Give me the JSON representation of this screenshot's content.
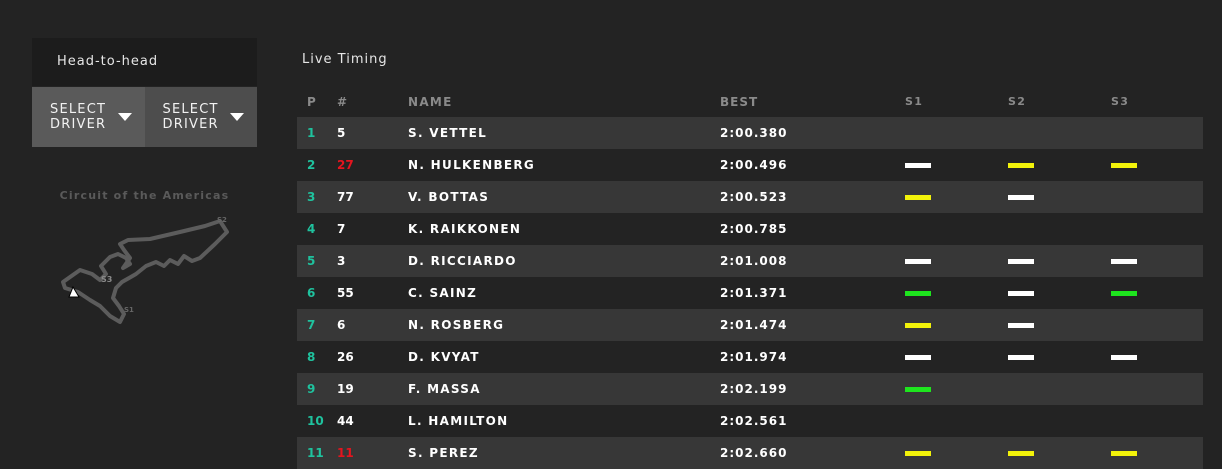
{
  "head_to_head": {
    "title": "Head-to-head",
    "select_a": "SELECT\nDRIVER",
    "select_b": "SELECT\nDRIVER"
  },
  "circuit": {
    "name": "Circuit of the Americas",
    "labels": {
      "s1": "S1",
      "s2": "S2",
      "s3": "S3"
    }
  },
  "live_timing": {
    "title": "Live Timing",
    "columns": {
      "p": "P",
      "num": "#",
      "name": "NAME",
      "best": "BEST",
      "s1": "S1",
      "s2": "S2",
      "s3": "S3"
    },
    "colors": {
      "white": "#ffffff",
      "yellow": "#f2f20a",
      "green": "#1ee51e",
      "teal": "#1fc29e",
      "red": "#e5141e"
    },
    "rows": [
      {
        "p": "1",
        "num": "5",
        "num_color": "#ffffff",
        "name": "S. VETTEL",
        "best": "2:00.380",
        "s1": "",
        "s2": "",
        "s3": ""
      },
      {
        "p": "2",
        "num": "27",
        "num_color": "#e5141e",
        "name": "N. HULKENBERG",
        "best": "2:00.496",
        "s1": "white",
        "s2": "yellow",
        "s3": "yellow"
      },
      {
        "p": "3",
        "num": "77",
        "num_color": "#ffffff",
        "name": "V. BOTTAS",
        "best": "2:00.523",
        "s1": "yellow",
        "s2": "white",
        "s3": ""
      },
      {
        "p": "4",
        "num": "7",
        "num_color": "#ffffff",
        "name": "K. RAIKKONEN",
        "best": "2:00.785",
        "s1": "",
        "s2": "",
        "s3": ""
      },
      {
        "p": "5",
        "num": "3",
        "num_color": "#ffffff",
        "name": "D. RICCIARDO",
        "best": "2:01.008",
        "s1": "white",
        "s2": "white",
        "s3": "white"
      },
      {
        "p": "6",
        "num": "55",
        "num_color": "#ffffff",
        "name": "C. SAINZ",
        "best": "2:01.371",
        "s1": "green",
        "s2": "white",
        "s3": "green"
      },
      {
        "p": "7",
        "num": "6",
        "num_color": "#ffffff",
        "name": "N. ROSBERG",
        "best": "2:01.474",
        "s1": "yellow",
        "s2": "white",
        "s3": ""
      },
      {
        "p": "8",
        "num": "26",
        "num_color": "#ffffff",
        "name": "D. KVYAT",
        "best": "2:01.974",
        "s1": "white",
        "s2": "white",
        "s3": "white"
      },
      {
        "p": "9",
        "num": "19",
        "num_color": "#ffffff",
        "name": "F. MASSA",
        "best": "2:02.199",
        "s1": "green",
        "s2": "",
        "s3": ""
      },
      {
        "p": "10",
        "num": "44",
        "num_color": "#ffffff",
        "name": "L. HAMILTON",
        "best": "2:02.561",
        "s1": "",
        "s2": "",
        "s3": ""
      },
      {
        "p": "11",
        "num": "11",
        "num_color": "#e5141e",
        "name": "S. PEREZ",
        "best": "2:02.660",
        "s1": "yellow",
        "s2": "yellow",
        "s3": "yellow"
      }
    ]
  }
}
